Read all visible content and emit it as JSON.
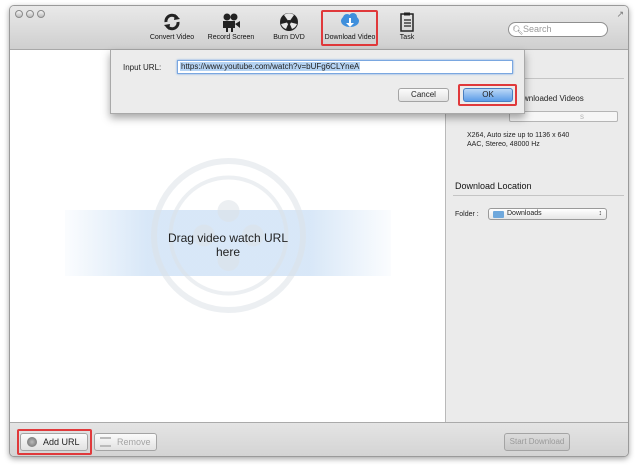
{
  "toolbar": {
    "items": [
      {
        "label": "Convert Video",
        "icon": "refresh-icon"
      },
      {
        "label": "Record Screen",
        "icon": "video-camera-icon"
      },
      {
        "label": "Burn DVD",
        "icon": "radiation-disc-icon"
      },
      {
        "label": "Download Video",
        "icon": "cloud-download-icon",
        "active": true
      },
      {
        "label": "Task",
        "icon": "clipboard-icon"
      }
    ],
    "search_placeholder": "Search"
  },
  "dialog": {
    "label": "Input URL:",
    "url_value": "https://www.youtube.com/watch?v=bUFg6CLYneA",
    "cancel_label": "Cancel",
    "ok_label": "OK"
  },
  "main": {
    "drop_text": "Drag video watch URL here"
  },
  "sidebar": {
    "partial_heading": "wnloaded Videos",
    "partial_button": "s",
    "format_line1": "X264, Auto size up to 1136 x 640",
    "format_line2": "AAC, Stereo, 48000 Hz",
    "download_location_heading": "Download Location",
    "folder_label": "Folder :",
    "folder_value": "Downloads"
  },
  "bottom": {
    "add_url_label": "Add URL",
    "remove_label": "Remove",
    "start_download_label": "Start Download"
  },
  "colors": {
    "highlight": "#e0393b",
    "ok_blue": "#5c9de8",
    "selection": "#b5d3f3"
  }
}
